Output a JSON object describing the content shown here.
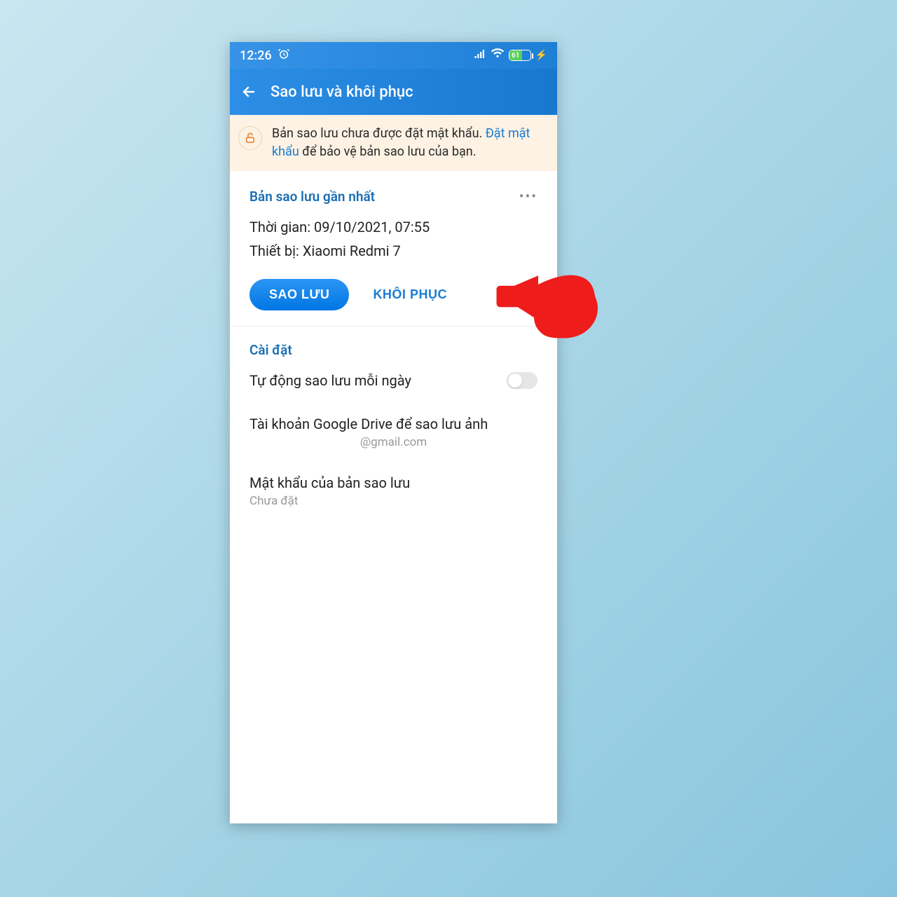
{
  "statusbar": {
    "time": "12:26",
    "battery_pct": "61"
  },
  "appbar": {
    "title": "Sao lưu và khôi phục"
  },
  "warning": {
    "text_before": "Bản sao lưu chưa được đặt mật khẩu. ",
    "link": "Đặt mật khẩu",
    "text_after": " để bảo vệ bản sao lưu của bạn."
  },
  "backup_card": {
    "section_label": "Bản sao lưu gần nhất",
    "time_label": "Thời gian: 09/10/2021, 07:55",
    "device_label": "Thiết bị: Xiaomi Redmi 7",
    "primary_btn": "SAO LƯU",
    "secondary_btn": "KHÔI PHỤC",
    "more": "•••"
  },
  "settings": {
    "section_label": "Cài đặt",
    "auto_backup_label": "Tự động sao lưu mỗi ngày",
    "gdrive_label": "Tài khoản Google Drive để sao lưu ảnh",
    "gdrive_account": "@gmail.com",
    "password_label": "Mật khẩu của bản sao lưu",
    "password_status": "Chưa đặt"
  }
}
